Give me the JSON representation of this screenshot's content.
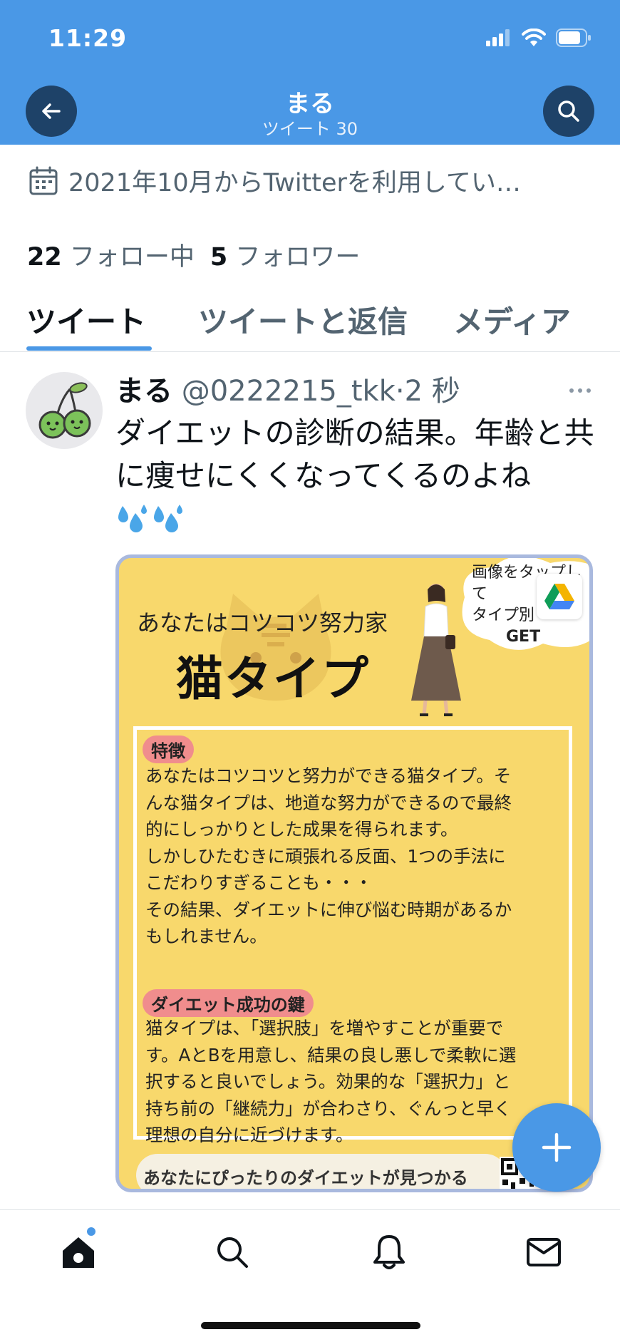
{
  "status_bar": {
    "time": "11:29"
  },
  "header": {
    "title": "まる",
    "subtitle": "ツイート 30"
  },
  "profile": {
    "joined": "2021年10月からTwitterを利用してい…",
    "following_count": "22",
    "following_label": "フォロー中",
    "followers_count": "5",
    "followers_label": "フォロワー"
  },
  "tabs": [
    {
      "label": "ツイート",
      "active": true
    },
    {
      "label": "ツイートと返信",
      "active": false
    },
    {
      "label": "メディア",
      "active": false
    }
  ],
  "tweet": {
    "name": "まる",
    "handle": "@0222215_tkk",
    "time": "·2 秒",
    "text": "ダイエットの診断の結果。年齢と共に痩せにくくなってくるのよね",
    "image": {
      "cloud_line1": "画像をタップして",
      "cloud_line2": "タイプ別",
      "cloud_line3": "GET",
      "subtitle": "あなたはコツコツ努力家",
      "title": "猫タイプ",
      "section1_label": "特徴",
      "section1_text": "あなたはコツコツと努力ができる猫タイプ。そ\nんな猫タイプは、地道な努力ができるので最終\n的にしっかりとした成果を得られます。\nしかしひたむきに頑張れる反面、1つの手法に\nこだわりすぎることも・・・\nその結果、ダイエットに伸び悩む時期があるか\nもしれません。",
      "section2_label": "ダイエット成功の鍵",
      "section2_text": "猫タイプは、「選択肢」を増やすことが重要で\nす。AとBを用意し、結果の良し悪しで柔軟に選\n択すると良いでしょう。効果的な「選択力」と\n持ち前の「継続力」が合わさり、ぐんっと早く\n理想の自分に近づけます。",
      "footer_text": "あなたにぴったりのダイエットが見つかる"
    }
  },
  "colors": {
    "accent": "#4a98e6",
    "header_button": "#1e4268",
    "card_bg": "#f8d86c",
    "badge": "#f08d8d"
  },
  "icons": [
    "back-arrow-icon",
    "search-icon",
    "calendar-icon",
    "more-icon",
    "sweat-drops-icon",
    "google-drive-icon",
    "compose-plus-icon",
    "home-icon",
    "bell-icon",
    "mail-icon"
  ]
}
